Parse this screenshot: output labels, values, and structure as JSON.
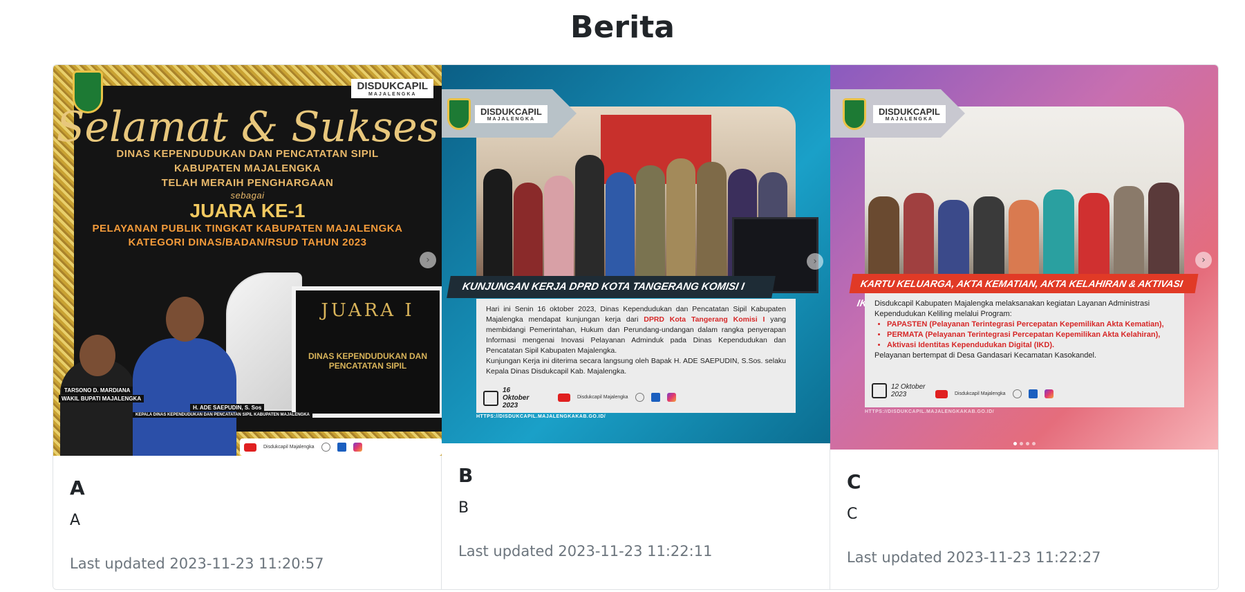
{
  "page": {
    "title": "Berita"
  },
  "cards": [
    {
      "title": "A",
      "text": "A",
      "updated": "Last updated 2023-11-23 11:20:57",
      "poster": {
        "brand": "DISDUKCAPIL",
        "brand_sub": "MAJALENGKA",
        "script": "Selamat & Sukses",
        "line1": "DINAS KEPENDUDUKAN DAN PENCATATAN SIPIL",
        "line2": "KABUPATEN MAJALENGKA",
        "line3": "TELAH MERAIH PENGHARGAAN",
        "line4": "sebagai",
        "juara": "JUARA KE-1",
        "line5": "PELAYANAN PUBLIK TINGKAT KABUPATEN MAJALENGKA",
        "line6": "KATEGORI DINAS/BADAN/RSUD TAHUN 2023",
        "plaque_title": "JUARA I",
        "plaque_sub": "DINAS KEPENDUDUKAN DAN PENCATATAN SIPIL",
        "cap1": "TARSONO D. MARDIANA",
        "cap2": "WAKIL BUPATI MAJALENGKA",
        "cap3": "H. ADE SAEPUDIN, S. Sos",
        "cap4": "KEPALA DINAS KEPENDUDUKAN DAN PENCATATAN SIPIL KABUPATEN MAJALENGKA",
        "yt": "Disdukcapil Majalengka"
      }
    },
    {
      "title": "B",
      "text": "B",
      "updated": "Last updated 2023-11-23 11:22:11",
      "poster": {
        "brand": "DISDUKCAPIL",
        "brand_sub": "MAJALENGKA",
        "headline": "KUNJUNGAN KERJA DPRD KOTA TANGERANG KOMISI I",
        "body_start": "Hari ini Senin 16 oktober 2023, Dinas Kependudukan dan Pencatatan Sipil Kabupaten Majalengka mendapat kunjungan kerja dari ",
        "body_red": "DPRD Kota Tangerang Komisi I",
        "body_end": " yang membidangi Pemerintahan, Hukum dan Perundang-undangan dalam rangka penyerapan Informasi mengenai Inovasi Pelayanan Adminduk pada Dinas Kependudukan dan Pencatatan Sipil Kabupaten Majalengka.",
        "body2": "Kunjungan Kerja ini diterima secara langsung oleh Bapak H. ADE SAEPUDIN, S.Sos. selaku Kepala Dinas Disdukcapil Kab. Majalengka.",
        "date": "16 Oktober 2023",
        "yt": "Disdukcapil Majalengka",
        "web": "https://disdukcapil.majalengkakab.go.id/",
        "fb": "Disdukcapil Majalengka",
        "ig": "Disdukcapil Majalengka",
        "url": "HTTPS://DISDUKCAPIL.MAJALENGKAKAB.GO.ID/"
      }
    },
    {
      "title": "C",
      "text": "C",
      "updated": "Last updated 2023-11-23 11:22:27",
      "poster": {
        "brand": "DISDUKCAPIL",
        "brand_sub": "MAJALENGKA",
        "headline": "KARTU KELUARGA, AKTA KEMATIAN, AKTA KELAHIRAN & AKTIVASI IKD",
        "intro": "Disdukcapil Kabupaten Majalengka melaksanakan kegiatan Layanan Administrasi Kependudukan Keliling melalui Program:",
        "items": [
          "PAPASTEN (Pelayanan Terintegrasi Percepatan Kepemilikan Akta Kematian),",
          "PERMATA (Pelayanan Terintegrasi Percepatan Kepemilikan Akta Kelahiran),",
          "Aktivasi Identitas Kependudukan Digital (IKD)."
        ],
        "location": "Pelayanan bertempat di Desa Gandasari Kecamatan Kasokandel.",
        "date": "12 Oktober 2023",
        "yt": "Disdukcapil Majalengka",
        "web": "https://disdukcapil.majalengkakab.go.id/",
        "fb": "Disdukcapil Majalengka",
        "ig": "Disdukcapil Majalengka",
        "url": "HTTPS://DISDUKCAPIL.MAJALENGKAKAB.GO.ID/"
      }
    }
  ],
  "icons": {
    "next": "chevron-right-icon"
  },
  "colors": {
    "accent_red": "#d62828",
    "muted_text": "#6c757d",
    "card_border": "#dfe2e5"
  }
}
